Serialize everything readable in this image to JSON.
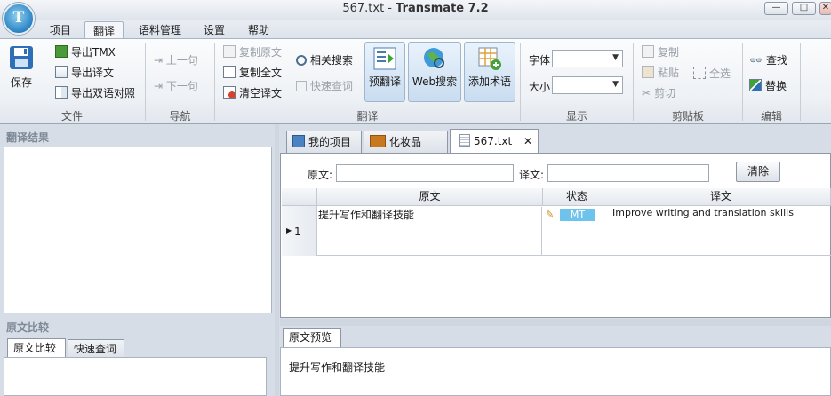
{
  "window": {
    "filename": "567.txt",
    "separator": " - ",
    "app": "Transmate 7.2",
    "logo_letter": "T",
    "controls": {
      "min": "—",
      "max": "□",
      "close": "✕"
    }
  },
  "menu": {
    "tabs": [
      "项目",
      "翻译",
      "语料管理",
      "设置",
      "帮助"
    ],
    "active": "翻译"
  },
  "ribbon": {
    "file": {
      "label": "文件",
      "save": "保存",
      "export_tmx": "导出TMX",
      "export_target": "导出译文",
      "export_bilingual": "导出双语对照"
    },
    "nav": {
      "label": "导航",
      "prev": "上一句",
      "next": "下一句"
    },
    "translate": {
      "label": "翻译",
      "copy_source": "复制原文",
      "copy_all": "复制全文",
      "clear_target": "清空译文",
      "related_search": "相关搜索",
      "quick_lookup": "快速查词",
      "pretranslate": "预翻译",
      "web_search": "Web搜索",
      "add_term": "添加术语"
    },
    "display": {
      "label": "显示",
      "font_label": "字体",
      "size_label": "大小",
      "font_value": "",
      "size_value": ""
    },
    "clipboard": {
      "label": "剪贴板",
      "copy": "复制",
      "paste": "粘贴",
      "cut": "剪切",
      "select_all": "全选"
    },
    "edit": {
      "label": "编辑",
      "find": "查找",
      "replace": "替换"
    }
  },
  "left_panel": {
    "results_title": "翻译结果",
    "compare_title": "原文比较",
    "tabs": [
      "原文比较",
      "快速查词"
    ]
  },
  "doc_tabs": [
    {
      "label": "我的项目"
    },
    {
      "label": "化妆品"
    },
    {
      "label": "567.txt",
      "close": "✕"
    }
  ],
  "filter": {
    "source_label": "原文:",
    "target_label": "译文:",
    "source_value": "",
    "target_value": "",
    "clear_button": "清除"
  },
  "grid": {
    "headers": {
      "source": "原文",
      "status": "状态",
      "target": "译文"
    },
    "rows": [
      {
        "num": "1",
        "source": "提升写作和翻译技能",
        "status": "MT",
        "target": "Improve writing and translation skills"
      }
    ]
  },
  "preview": {
    "tab": "原文预览",
    "text": "提升写作和翻译技能"
  },
  "colors": {
    "accent": "#2a83c4",
    "mt_badge": "#6ec3ec",
    "panel_bg": "#d7dde6"
  }
}
